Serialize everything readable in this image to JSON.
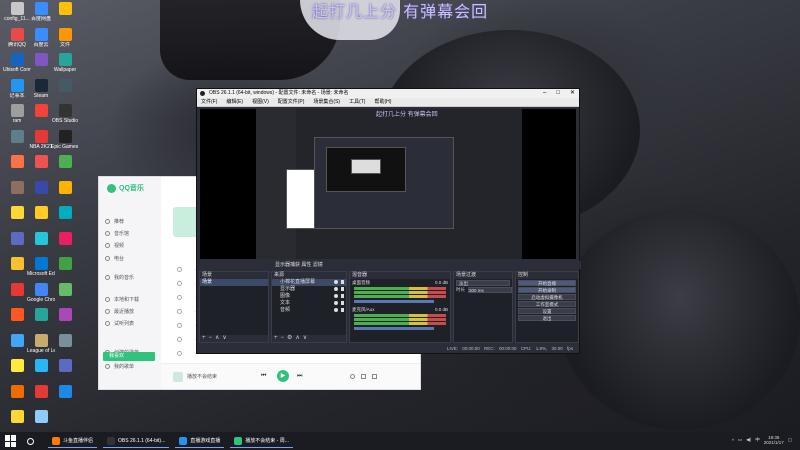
{
  "overlay": {
    "text": "起打几上分 有弹幕会回"
  },
  "desktop_icons": [
    {
      "label": "config_11...",
      "color": "#c8c8c8"
    },
    {
      "label": "百度网盘",
      "color": "#3a8dff"
    },
    {
      "label": "",
      "color": "#ffc107"
    },
    {
      "label": "腾讯QQ",
      "color": "#e84a4a"
    },
    {
      "label": "百度云",
      "color": "#3a8dff"
    },
    {
      "label": "文件",
      "color": "#ff9800"
    },
    {
      "label": "Ubisoft Connect",
      "color": "#1565c0"
    },
    {
      "label": "",
      "color": "#7e57c2"
    },
    {
      "label": "Wallpaper",
      "color": "#26a69a"
    },
    {
      "label": "记事本",
      "color": "#2196f3"
    },
    {
      "label": "Steam",
      "color": "#1b2838"
    },
    {
      "label": "",
      "color": "#455a64"
    },
    {
      "label": "ram",
      "color": "#9e9e9e"
    },
    {
      "label": "",
      "color": "#f44336"
    },
    {
      "label": "OBS Studio",
      "color": "#333"
    },
    {
      "label": "",
      "color": "#607d8b"
    },
    {
      "label": "NBA 2K21",
      "color": "#e53935"
    },
    {
      "label": "Epic Games Launcher",
      "color": "#222"
    },
    {
      "label": "",
      "color": "#ff7043"
    },
    {
      "label": "",
      "color": "#ef5350"
    },
    {
      "label": "",
      "color": "#4caf50"
    },
    {
      "label": "",
      "color": "#8d6e63"
    },
    {
      "label": "",
      "color": "#3949ab"
    },
    {
      "label": "",
      "color": "#ffb300"
    },
    {
      "label": "",
      "color": "#fdd835"
    },
    {
      "label": "",
      "color": "#ffca28"
    },
    {
      "label": "",
      "color": "#00acc1"
    },
    {
      "label": "",
      "color": "#5c6bc0"
    },
    {
      "label": "",
      "color": "#26c6da"
    },
    {
      "label": "",
      "color": "#e91e63"
    },
    {
      "label": "",
      "color": "#fbc02d"
    },
    {
      "label": "Microsoft Edge",
      "color": "#0078d4"
    },
    {
      "label": "",
      "color": "#43a047"
    },
    {
      "label": "",
      "color": "#e53935"
    },
    {
      "label": "Google Chrome",
      "color": "#4285f4"
    },
    {
      "label": "",
      "color": "#66bb6a"
    },
    {
      "label": "",
      "color": "#ff5722"
    },
    {
      "label": "",
      "color": "#26a69a"
    },
    {
      "label": "",
      "color": "#ab47bc"
    },
    {
      "label": "",
      "color": "#42a5f5"
    },
    {
      "label": "League of Legends",
      "color": "#c8aa6e"
    },
    {
      "label": "",
      "color": "#78909c"
    },
    {
      "label": "",
      "color": "#ffeb3b"
    },
    {
      "label": "",
      "color": "#29b6f6"
    },
    {
      "label": "",
      "color": "#5c6bc0"
    },
    {
      "label": "",
      "color": "#ef6c00"
    },
    {
      "label": "",
      "color": "#e53935"
    },
    {
      "label": "",
      "color": "#1e88e5"
    },
    {
      "label": "",
      "color": "#fdd835"
    },
    {
      "label": "",
      "color": "#90caf9"
    }
  ],
  "qq": {
    "logo": "QQ音乐",
    "nav": [
      "推荐",
      "音乐馆",
      "视频",
      "电台",
      "我的音乐",
      "我喜欢",
      "本地和下载",
      "最近播放",
      "试听列表",
      "创建的歌单",
      "我的歌单"
    ],
    "selected": "我喜欢",
    "rows": [
      "",
      "",
      "",
      "",
      "",
      "",
      "",
      "",
      "我的浏览历史"
    ],
    "playlist_caption": "播放不会结束"
  },
  "obs": {
    "title": "OBS 26.1.1 (64-bit, windows) - 配置文件: 未命名 - 场景: 未命名",
    "menu": [
      "文件(F)",
      "编辑(E)",
      "视图(V)",
      "配置文件(P)",
      "场景集合(S)",
      "工具(T)",
      "帮助(H)"
    ],
    "midbar": "显示器捕获   属性   滤镜",
    "scenes": {
      "title": "场景",
      "items": [
        "场景"
      ]
    },
    "sources": {
      "title": "来源",
      "items": [
        "小棉花直播屏幕",
        "显示器",
        "图像",
        "文本",
        "音频"
      ]
    },
    "mixer": {
      "title": "混音器",
      "channels": [
        "桌面音频",
        "麦克风/Aux"
      ],
      "values": [
        "0.0 dB",
        "0.0 dB"
      ]
    },
    "transitions": {
      "title": "场景过渡",
      "type": "淡出",
      "duration_label": "时长",
      "duration": "300 ms"
    },
    "controls": {
      "title": "控制",
      "buttons": [
        "开始直播",
        "开始录制",
        "启动虚拟摄像机",
        "工作室模式",
        "设置",
        "退出"
      ]
    },
    "status": "LIVE: 00:00:00  REC: 00:00:00  CPU: 1.8%, 30.00 fps"
  },
  "taskbar": {
    "items": [
      {
        "label": "斗鱼直播伴侣",
        "color": "#ff7a00"
      },
      {
        "label": "OBS 26.1.1 (64-bit)...",
        "color": "#333"
      },
      {
        "label": "直播游戏直播",
        "color": "#2196f3"
      },
      {
        "label": "播放不会结束 - 周...",
        "color": "#31c27c"
      }
    ],
    "time": "19:36",
    "date": "2021/1/17"
  },
  "colors": {
    "qq_green": "#31c27c",
    "obs_dark": "#2b2e38",
    "obs_select": "#3c4a68"
  }
}
